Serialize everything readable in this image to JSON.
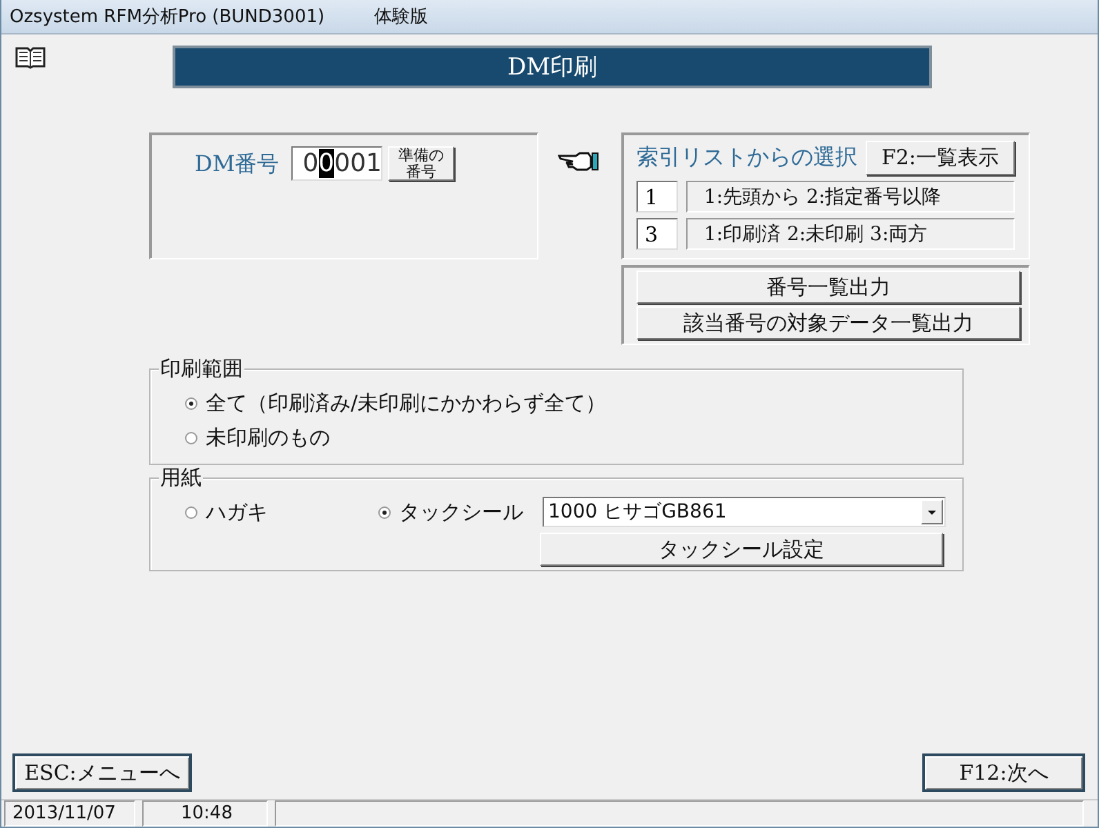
{
  "window": {
    "title": "Ozsystem RFM分析Pro (BUND3001)",
    "edition": "体験版"
  },
  "header": {
    "title": "DM印刷"
  },
  "dm_number": {
    "label": "DM番号",
    "value_parts": [
      {
        "text": "0",
        "selected": false
      },
      {
        "text": "0",
        "selected": true
      },
      {
        "text": "001",
        "selected": false
      }
    ],
    "button_lines": [
      "準備の",
      "番号"
    ]
  },
  "index_select": {
    "label": "索引リストからの選択",
    "button": "F2:一覧表示",
    "options": [
      {
        "value": "1",
        "description": "1:先頭から 2:指定番号以降"
      },
      {
        "value": "3",
        "description": "1:印刷済 2:未印刷 3:両方"
      }
    ]
  },
  "output_buttons": [
    "番号一覧出力",
    "該当番号の対象データ一覧出力"
  ],
  "print_range": {
    "title": "印刷範囲",
    "options": [
      {
        "label": "全て（印刷済み/未印刷にかかわらず全て）",
        "selected": true
      },
      {
        "label": "未印刷のもの",
        "selected": false
      }
    ]
  },
  "paper": {
    "title": "用紙",
    "options": [
      {
        "label": "ハガキ",
        "selected": false
      },
      {
        "label": "タックシール",
        "selected": true
      }
    ],
    "label_type": "1000 ヒサゴGB861",
    "settings_button": "タックシール設定"
  },
  "footer": {
    "buttons": [
      "ESC:メニューへ",
      "F12:次へ"
    ]
  },
  "status_bar": {
    "date": "2013/11/07",
    "time": "10:48"
  }
}
